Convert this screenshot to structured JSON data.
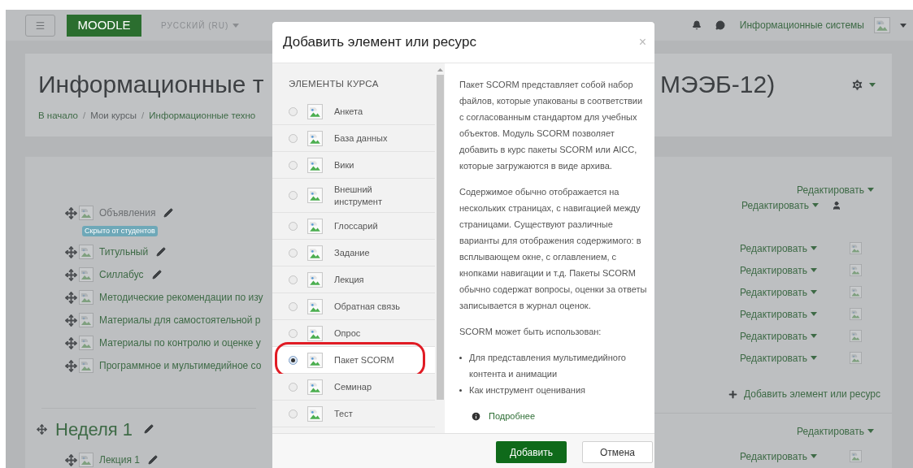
{
  "navbar": {
    "logo": "MOODLE",
    "language": "РУССКИЙ (RU)",
    "user_name": "Информационные системы"
  },
  "course": {
    "title_start": "Информационные т",
    "title_end": "МЭЭБ-12)",
    "breadcrumb": [
      {
        "label": "В начало",
        "kind": "link"
      },
      {
        "label": "Мои курсы",
        "kind": "plain",
        "separator": "/"
      },
      {
        "label": "Информационные техно",
        "kind": "link",
        "separator": "/"
      }
    ]
  },
  "section_0": {
    "activities": [
      {
        "name": "Объявления",
        "hidden": true,
        "badge": "Скрыто от студентов",
        "pencil": true
      },
      {
        "name": "Титульный",
        "hidden": false,
        "pencil": true
      },
      {
        "name": "Силлабус",
        "hidden": false,
        "pencil": true
      },
      {
        "name": "Методические рекомендации по изу",
        "hidden": false,
        "pencil": false
      },
      {
        "name": "Материалы для самостоятельной р",
        "hidden": false,
        "pencil": false
      },
      {
        "name": "Материалы по контролю и оценке у",
        "hidden": false,
        "pencil": false
      },
      {
        "name": "Программное и мультимедийное со",
        "hidden": false,
        "pencil": false
      }
    ],
    "controls": [
      {
        "label": "Редактировать",
        "kind": "section"
      },
      {
        "label": "Редактировать",
        "kind": "user"
      },
      {
        "label": "Редактировать",
        "kind": "activity"
      },
      {
        "label": "Редактировать",
        "kind": "activity"
      },
      {
        "label": "Редактировать",
        "kind": "activity"
      },
      {
        "label": "Редактировать",
        "kind": "activity"
      },
      {
        "label": "Редактировать",
        "kind": "activity"
      },
      {
        "label": "Редактировать",
        "kind": "activity"
      }
    ],
    "add_activity": "Добавить элемент или ресурс"
  },
  "section_1": {
    "title": "Неделя 1",
    "activities": [
      {
        "name": "Лекция 1",
        "hidden": false,
        "pencil": true
      }
    ],
    "controls": [
      {
        "label": "Редактировать",
        "kind": "section"
      },
      {
        "label": "Редактировать",
        "kind": "activity"
      }
    ]
  },
  "modal": {
    "title": "Добавить элемент или ресурс",
    "close": "×",
    "list_heading": "ЭЛЕМЕНТЫ КУРСА",
    "items": [
      {
        "label": "Анкета",
        "selected": false,
        "circled": false
      },
      {
        "label": "База данных",
        "selected": false,
        "circled": false
      },
      {
        "label": "Вики",
        "selected": false,
        "circled": false
      },
      {
        "label": "Внешний инструмент",
        "selected": false,
        "circled": false
      },
      {
        "label": "Глоссарий",
        "selected": false,
        "circled": false
      },
      {
        "label": "Задание",
        "selected": false,
        "circled": false
      },
      {
        "label": "Лекция",
        "selected": false,
        "circled": false
      },
      {
        "label": "Обратная связь",
        "selected": false,
        "circled": false
      },
      {
        "label": "Опрос",
        "selected": false,
        "circled": false
      },
      {
        "label": "Пакет SCORM",
        "selected": true,
        "circled": true
      },
      {
        "label": "Семинар",
        "selected": false,
        "circled": false
      },
      {
        "label": "Тест",
        "selected": false,
        "circled": false
      }
    ],
    "paragraphs": [
      "Пакет SCORM представляет собой набор файлов, которые упакованы в соответствии с согласованным стандартом для учебных объектов. Модуль SCORM позволяет добавить в курс пакеты SCORM или AICC, которые загружаются в виде архива.",
      "Содержимое обычно отображается на нескольких страницах, с навигацией между страницами. Существуют различные варианты для отображения содержимого: в всплывающем окне, с оглавлением, с кнопками навигации и т.д. Пакеты SCORM обычно содержат вопросы, оценки за ответы записывается в журнал оценок.",
      "SCORM может быть использован:"
    ],
    "bullets": [
      "Для представления мультимедийного контента и анимации",
      "Как инструмент оценивания"
    ],
    "more_link": "Подробнее",
    "buttons": [
      {
        "label": "Добавить",
        "kind": "primary"
      },
      {
        "label": "Отмена",
        "kind": "secondary"
      }
    ]
  }
}
